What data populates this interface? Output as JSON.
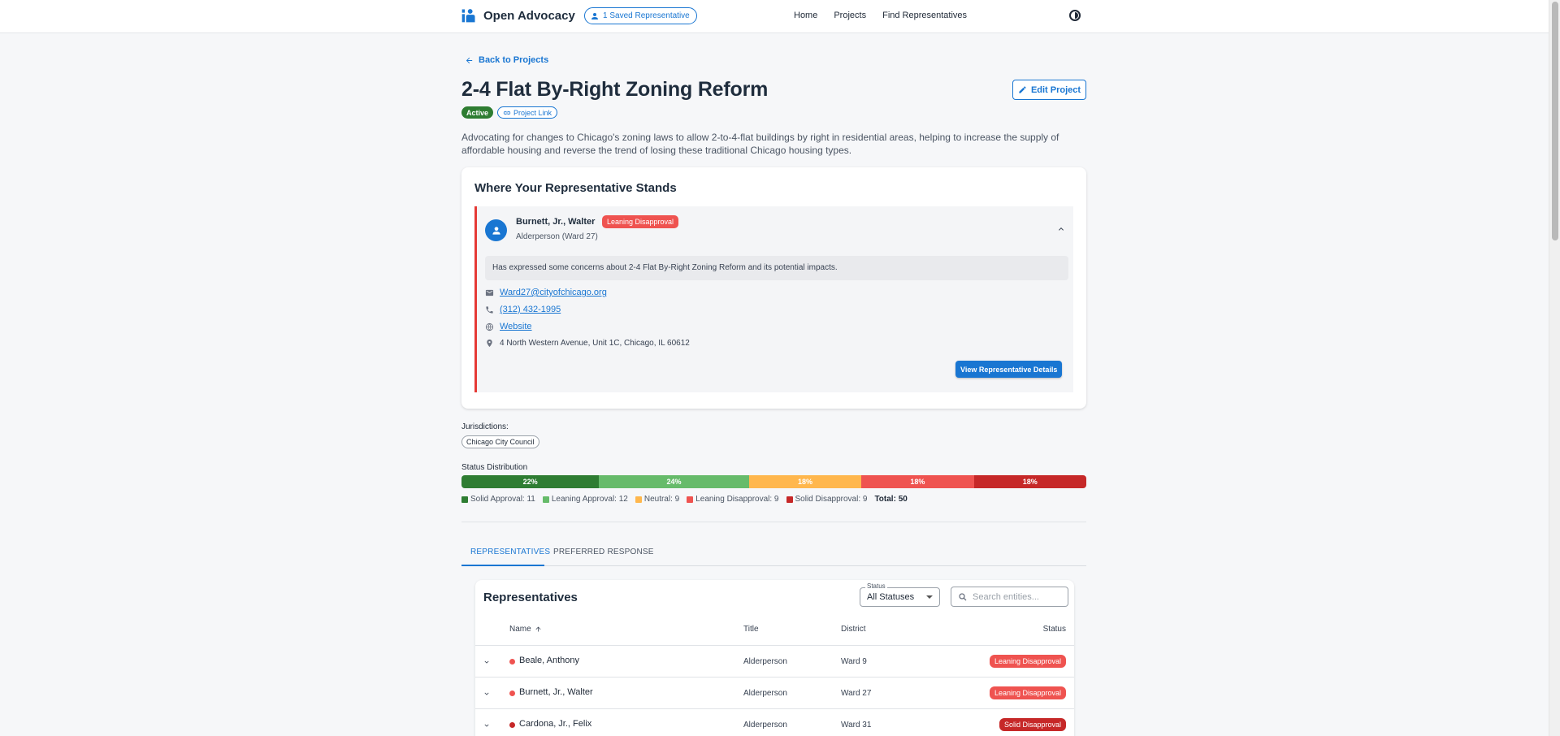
{
  "header": {
    "brand": "Open Advocacy",
    "saved_pill": "1 Saved Representative",
    "nav": [
      "Home",
      "Projects",
      "Find Representatives"
    ]
  },
  "page": {
    "back_link": "Back to Projects",
    "title": "2-4 Flat By-Right Zoning Reform",
    "edit_button": "Edit Project",
    "status_badge": "Active",
    "project_link": "Project Link",
    "description": "Advocating for changes to Chicago's zoning laws to allow 2-to-4-flat buildings by right in residential areas, helping to increase the supply of affordable housing and reverse the trend of losing these traditional Chicago housing types."
  },
  "stand_card": {
    "title": "Where Your Representative Stands",
    "rep": {
      "name": "Burnett, Jr., Walter",
      "status": "Leaning Disapproval",
      "role": "Alderperson (Ward 27)",
      "note": "Has expressed some concerns about 2-4 Flat By-Right Zoning Reform and its potential impacts.",
      "email": "Ward27@cityofchicago.org",
      "phone": "(312) 432-1995",
      "website": "Website",
      "address": "4 North Western Avenue, Unit 1C, Chicago, IL 60612",
      "details_button": "View Representative Details"
    }
  },
  "jurisdictions": {
    "label": "Jurisdictions:",
    "items": [
      "Chicago City Council"
    ]
  },
  "distribution": {
    "label": "Status Distribution",
    "segments": [
      {
        "name": "Solid Approval",
        "count": 11,
        "percent": "22%",
        "fraction": 0.22,
        "color": "#2e7d32"
      },
      {
        "name": "Leaning Approval",
        "count": 12,
        "percent": "24%",
        "fraction": 0.24,
        "color": "#66bb6a"
      },
      {
        "name": "Neutral",
        "count": 9,
        "percent": "18%",
        "fraction": 0.18,
        "color": "#ffb74d"
      },
      {
        "name": "Leaning Disapproval",
        "count": 9,
        "percent": "18%",
        "fraction": 0.18,
        "color": "#ef5350"
      },
      {
        "name": "Solid Disapproval",
        "count": 9,
        "percent": "18%",
        "fraction": 0.18,
        "color": "#c62828"
      }
    ],
    "legend": [
      "Solid Approval: 11",
      "Leaning Approval: 12",
      "Neutral: 9",
      "Leaning Disapproval: 9",
      "Solid Disapproval: 9"
    ],
    "total": "Total: 50"
  },
  "tabs": {
    "items": [
      "REPRESENTATIVES",
      "PREFERRED RESPONSE"
    ],
    "active": "REPRESENTATIVES"
  },
  "table": {
    "title": "Representatives",
    "status_filter_label": "Status",
    "status_filter_value": "All Statuses",
    "search_placeholder": "Search entities...",
    "columns": [
      "Name",
      "Title",
      "District",
      "Status"
    ],
    "rows": [
      {
        "name": "Beale, Anthony",
        "title": "Alderperson",
        "district": "Ward 9",
        "status": "Leaning Disapproval",
        "color": "#ef5350"
      },
      {
        "name": "Burnett, Jr., Walter",
        "title": "Alderperson",
        "district": "Ward 27",
        "status": "Leaning Disapproval",
        "color": "#ef5350"
      },
      {
        "name": "Cardona, Jr., Felix",
        "title": "Alderperson",
        "district": "Ward 31",
        "status": "Solid Disapproval",
        "color": "#c62828"
      }
    ]
  }
}
